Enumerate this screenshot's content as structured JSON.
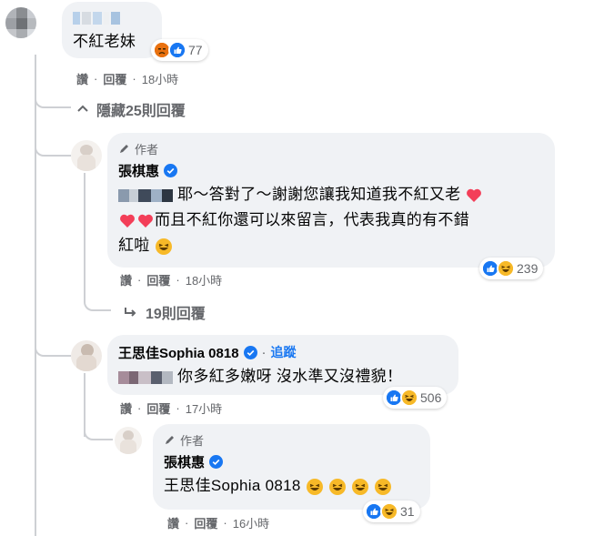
{
  "comments": {
    "top": {
      "text": "不紅老妹",
      "reaction_count": "77",
      "actions": {
        "like": "讚",
        "reply": "回覆",
        "time": "18小時"
      },
      "hidden_replies_toggle": "隱藏25則回覆"
    },
    "reply1": {
      "author_tag": "作者",
      "author": "張棋惠",
      "text_line1": "耶～答對了～謝謝您讓我知道我不紅又老",
      "text_line2": "而且不紅你還可以來留言，代表我真的有不錯",
      "text_line3": "紅啦",
      "reaction_count": "239",
      "actions": {
        "like": "讚",
        "reply": "回覆",
        "time": "18小時"
      },
      "more_replies": "19則回覆"
    },
    "reply2": {
      "author": "王思佳Sophia 0818",
      "follow": "追蹤",
      "text": "你多紅多嫩呀 沒水準又沒禮貌！",
      "reaction_count": "506",
      "actions": {
        "like": "讚",
        "reply": "回覆",
        "time": "17小時"
      }
    },
    "reply3": {
      "author_tag": "作者",
      "author": "張棋惠",
      "text": "王思佳Sophia 0818",
      "reaction_count": "31",
      "actions": {
        "like": "讚",
        "reply": "回覆",
        "time": "16小時"
      }
    }
  },
  "colors": {
    "bubble": "#f0f2f5",
    "link": "#1877f2",
    "meta": "#65676b",
    "like_blue": "#1877f2",
    "haha_yellow": "#f7b928",
    "heart_red": "#f33e58"
  },
  "icons": [
    "pencil-icon",
    "verified-icon",
    "like-reaction-icon",
    "haha-reaction-icon",
    "angry-reaction-icon",
    "heart-emoji",
    "grin-emoji",
    "chevron-up-icon",
    "reply-arrow-icon"
  ]
}
